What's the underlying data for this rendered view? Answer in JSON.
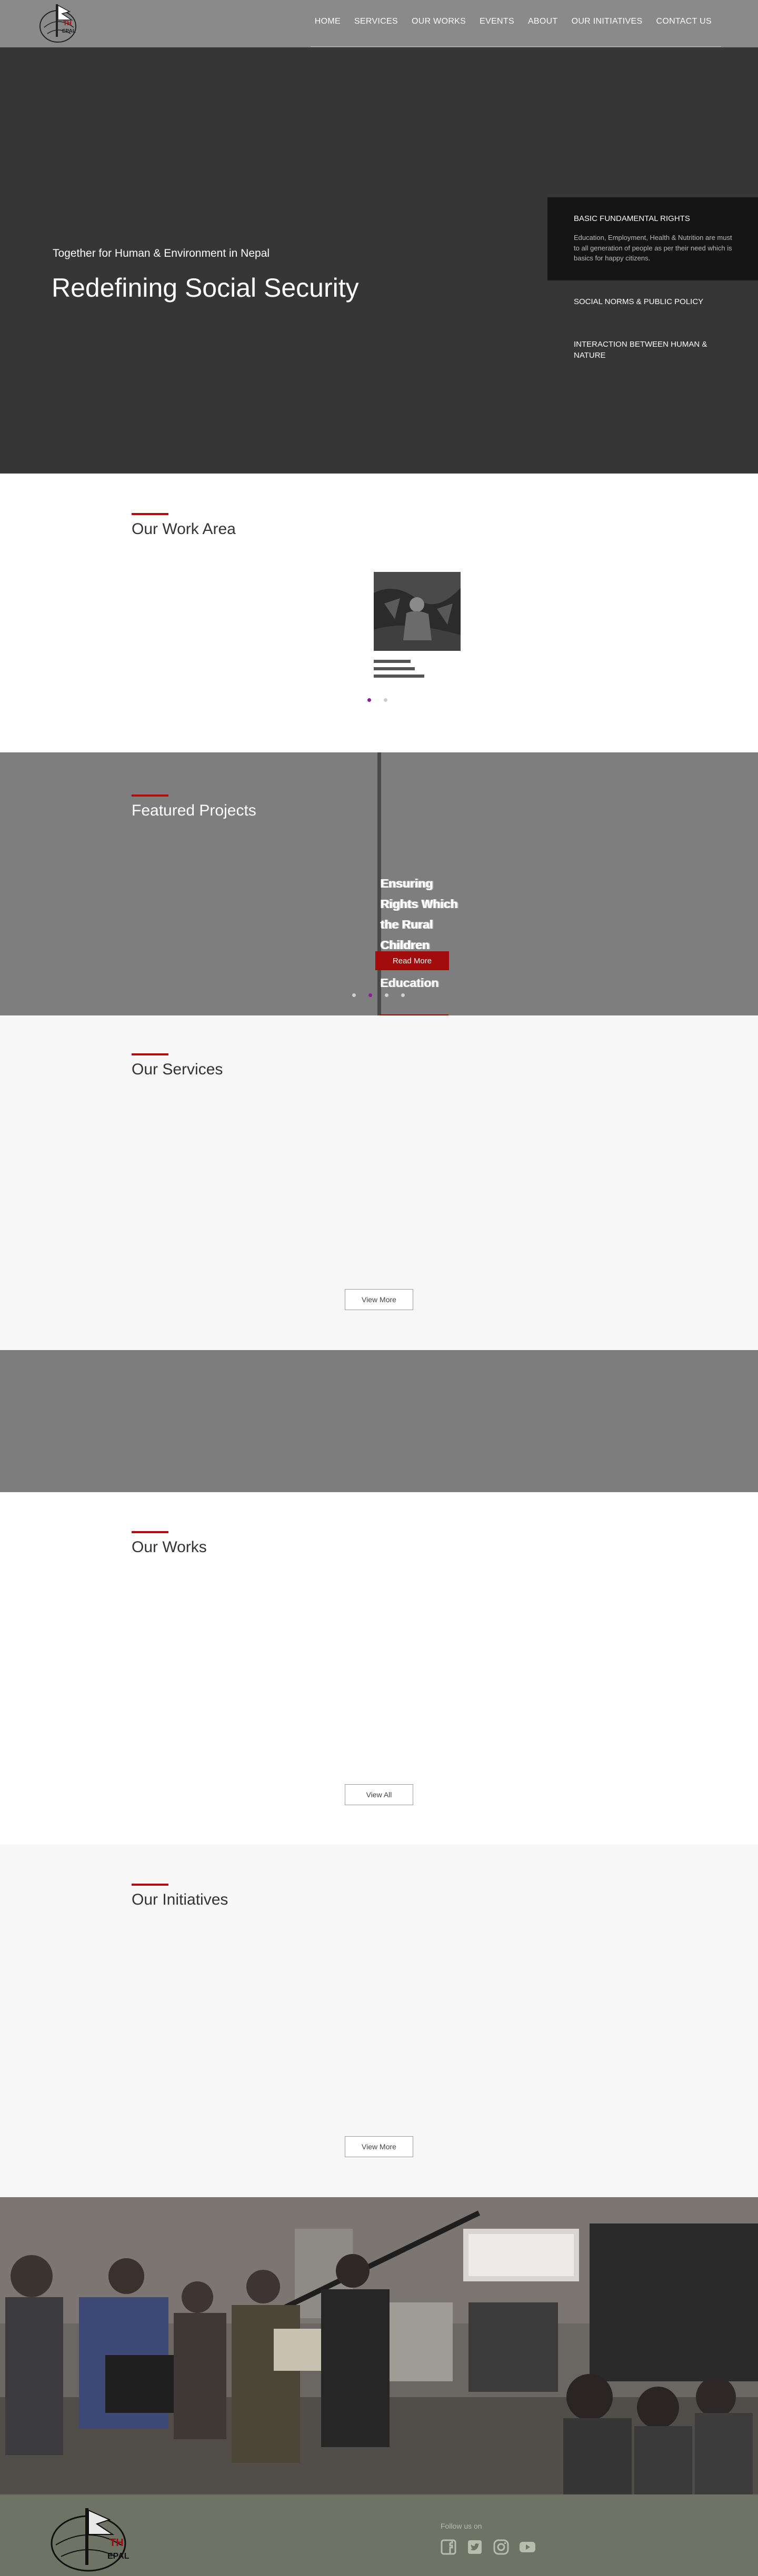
{
  "header": {
    "logo_alt": "THE NEPAL",
    "nav": [
      "HOME",
      "SERVICES",
      "OUR WORKS",
      "EVENTS",
      "ABOUT",
      "OUR INITIATIVES",
      "CONTACT US"
    ]
  },
  "hero": {
    "subtitle": "Together for Human & Environment in Nepal",
    "title": "Redefining Social Security",
    "items": [
      {
        "title": "BASIC FUNDAMENTAL RIGHTS",
        "desc": "Education, Employment, Health & Nutrition are must to all generation of people as per their need which is basics for happy citizens."
      },
      {
        "title": "SOCIAL NORMS & PUBLIC POLICY"
      },
      {
        "title": "INTERACTION BETWEEN HUMAN & NATURE"
      }
    ]
  },
  "work_area": {
    "title": "Our Work Area"
  },
  "featured": {
    "title": "Featured Projects",
    "headline": "Ensuring Rights Which the Rural Children",
    "read_more": "Read More",
    "caption": "Education"
  },
  "services": {
    "title": "Our Services",
    "button": "View More"
  },
  "works": {
    "title": "Our Works",
    "button": "View All"
  },
  "initiatives": {
    "title": "Our Initiatives",
    "button": "View More"
  },
  "footer": {
    "follow": "Follow us on",
    "logo_text": "THE NEPAL",
    "socials": [
      "facebook-icon",
      "twitter-icon",
      "instagram-icon",
      "youtube-icon"
    ]
  },
  "colors": {
    "accent_red": "#b20d0d",
    "dot_active": "#8e1b9c",
    "hero_bg": "#363636"
  }
}
